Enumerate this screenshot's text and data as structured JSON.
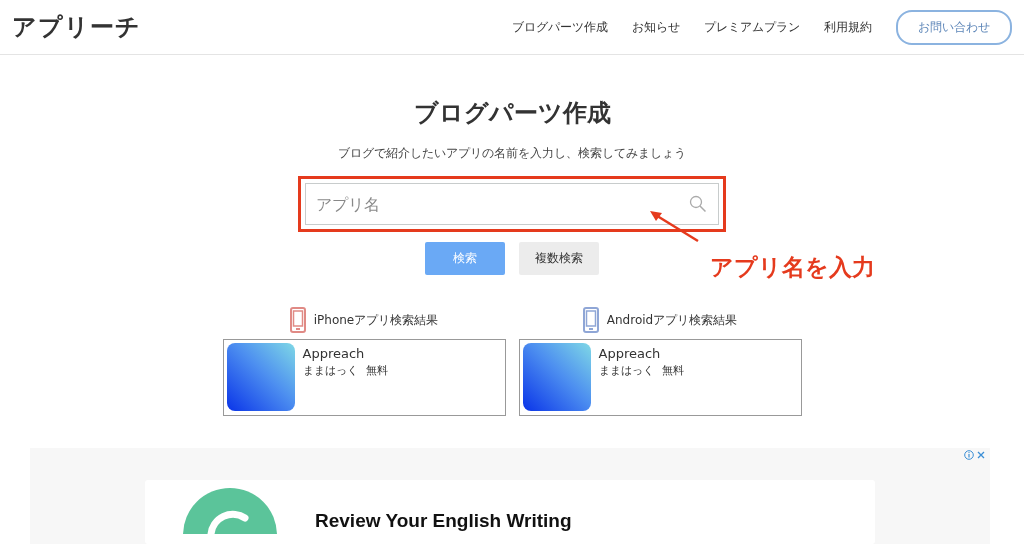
{
  "header": {
    "logo": "アプリーチ",
    "nav": [
      "ブログパーツ作成",
      "お知らせ",
      "プレミアムプラン",
      "利用規約"
    ],
    "contact_button": "お問い合わせ"
  },
  "main": {
    "title": "ブログパーツ作成",
    "subtitle": "ブログで紹介したいアプリの名前を入力し、検索してみましょう",
    "search": {
      "placeholder": "アプリ名"
    },
    "buttons": [
      {
        "label": "検索",
        "kind": "primary"
      },
      {
        "label": "複数検索",
        "kind": "secondary"
      }
    ],
    "annotation": "アプリ名を入力"
  },
  "results": [
    {
      "label": "iPhoneアプリ検索結果",
      "color": "#e08a85",
      "app": {
        "name": "Appreach",
        "developer": "ままはっく",
        "price": "無料"
      }
    },
    {
      "label": "Androidアプリ検索結果",
      "color": "#8fa6d6",
      "app": {
        "name": "Appreach",
        "developer": "ままはっく",
        "price": "無料"
      }
    }
  ],
  "ad": {
    "headline": "Review Your English Writing"
  }
}
